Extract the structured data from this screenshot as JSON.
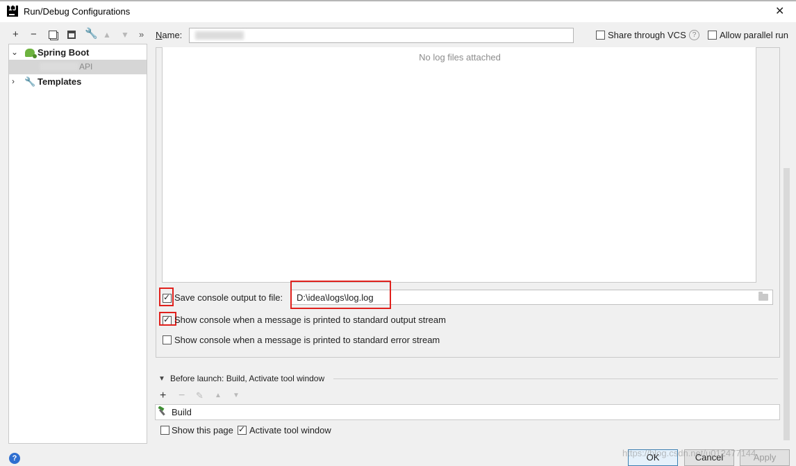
{
  "window": {
    "title": "Run/Debug Configurations",
    "app_icon_text": "IJ"
  },
  "toolbar": {
    "add": "+",
    "remove": "−",
    "more": "»"
  },
  "tree": {
    "spring_boot": "Spring Boot",
    "config_item": "API",
    "templates": "Templates"
  },
  "name_row": {
    "label": "Name:",
    "value": "",
    "share_label": "Share through VCS",
    "share_checked": false,
    "parallel_label": "Allow parallel run",
    "parallel_checked": false,
    "help": "?"
  },
  "logs": {
    "empty_text": "No log files attached",
    "save_output_label": "Save console output to file:",
    "save_output_checked": true,
    "file_path": "D:\\idea\\logs\\log.log",
    "show_stdout_label": "Show console when a message is printed to standard output stream",
    "show_stdout_checked": true,
    "show_stderr_label": "Show console when a message is printed to standard error stream",
    "show_stderr_checked": false
  },
  "before_launch": {
    "title": "Before launch: Build, Activate tool window",
    "add": "+",
    "remove": "−",
    "task": "Build",
    "show_page_label": "Show this page",
    "show_page_checked": false,
    "activate_label": "Activate tool window",
    "activate_checked": true
  },
  "buttons": {
    "ok": "OK",
    "cancel": "Cancel",
    "apply": "Apply"
  },
  "watermark": "https://blog.csdn.net/u012477144",
  "colors": {
    "highlight_box": "#e0201c",
    "spring_green": "#6db33f",
    "selection": "#d6d6d6"
  }
}
